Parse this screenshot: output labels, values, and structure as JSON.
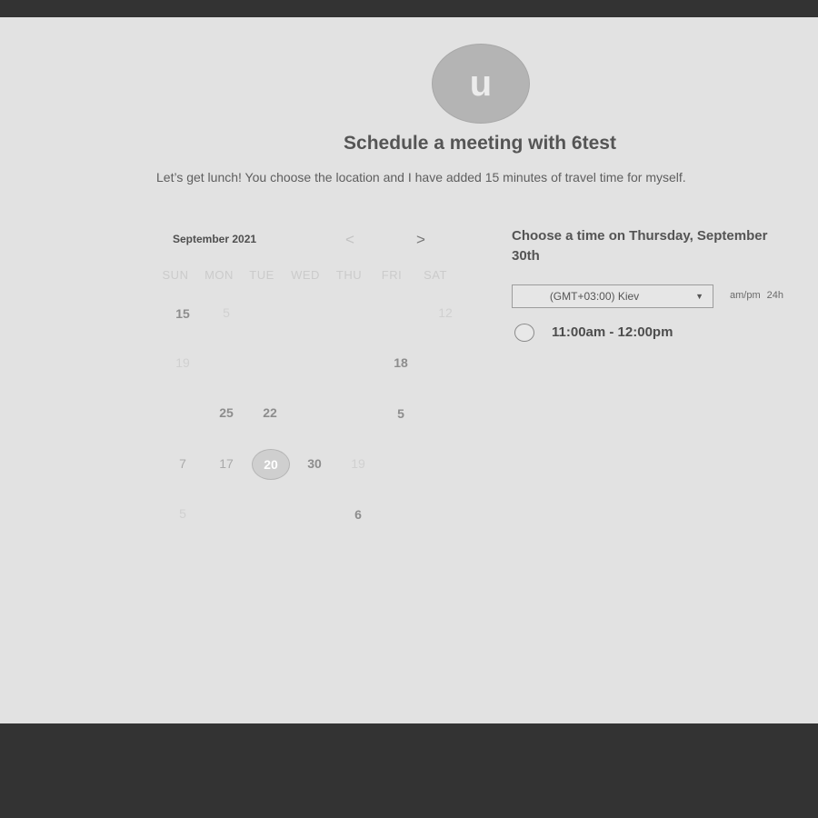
{
  "host": {
    "avatar_letter": "u",
    "title": "Schedule a meeting with 6test",
    "description": "Let’s get lunch! You choose the location and I have added 15 minutes of travel time for myself."
  },
  "calendar": {
    "month_label": "September 2021",
    "prev_icon": "chevron-left-icon",
    "next_icon": "chevron-right-icon",
    "prev_glyph": "<",
    "next_glyph": ">",
    "weekdays": [
      "SUN",
      "MON",
      "TUE",
      "WED",
      "THU",
      "FRI",
      "SAT"
    ],
    "weeks": [
      [
        "15",
        "5",
        "",
        "",
        "",
        "",
        "12"
      ],
      [
        "19",
        "",
        "",
        "",
        "",
        "18",
        ""
      ],
      [
        "",
        "25",
        "22",
        "",
        "",
        "5",
        ""
      ],
      [
        "7",
        "17",
        "20",
        "30",
        "19",
        "",
        ""
      ],
      [
        "5",
        "",
        "",
        "",
        "6",
        "",
        ""
      ]
    ],
    "selected_day": "20"
  },
  "times": {
    "heading": "Choose a time on Thursday, September 30th",
    "timezone": "(GMT+03:00) Kiev",
    "format_ampm": "am/pm",
    "format_24h": "24h",
    "slots": [
      {
        "label": "11:00am - 12:00pm"
      }
    ]
  },
  "colors": {
    "panel_bg": "#e2e2e2",
    "frame_bg": "#333333",
    "text_primary": "#555555"
  }
}
